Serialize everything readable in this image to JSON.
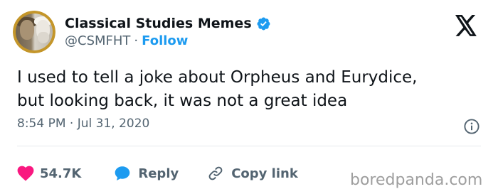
{
  "account": {
    "name": "Classical Studies Memes",
    "handle": "@CSMFHT",
    "separator": "·",
    "follow_label": "Follow"
  },
  "tweet": {
    "lines": [
      "I used to tell a joke about Orpheus and Eurydice,",
      "but looking back, it was not a great idea"
    ],
    "timestamp": "8:54 PM · Jul 31, 2020"
  },
  "actions": {
    "like_count": "54.7K",
    "reply_label": "Reply",
    "copy_label": "Copy link"
  },
  "watermark": "boredpanda.com",
  "icons": {
    "verified": "verified-badge-icon",
    "x_logo": "x-logo-icon",
    "info": "info-icon",
    "heart": "heart-icon",
    "reply": "speech-bubble-icon",
    "link": "link-icon"
  },
  "colors": {
    "text": "#0f1419",
    "muted": "#536471",
    "accent": "#1d9bf0",
    "like": "#f91880",
    "watermark": "#9e9e9e",
    "avatar_frame": "#c4962a"
  }
}
